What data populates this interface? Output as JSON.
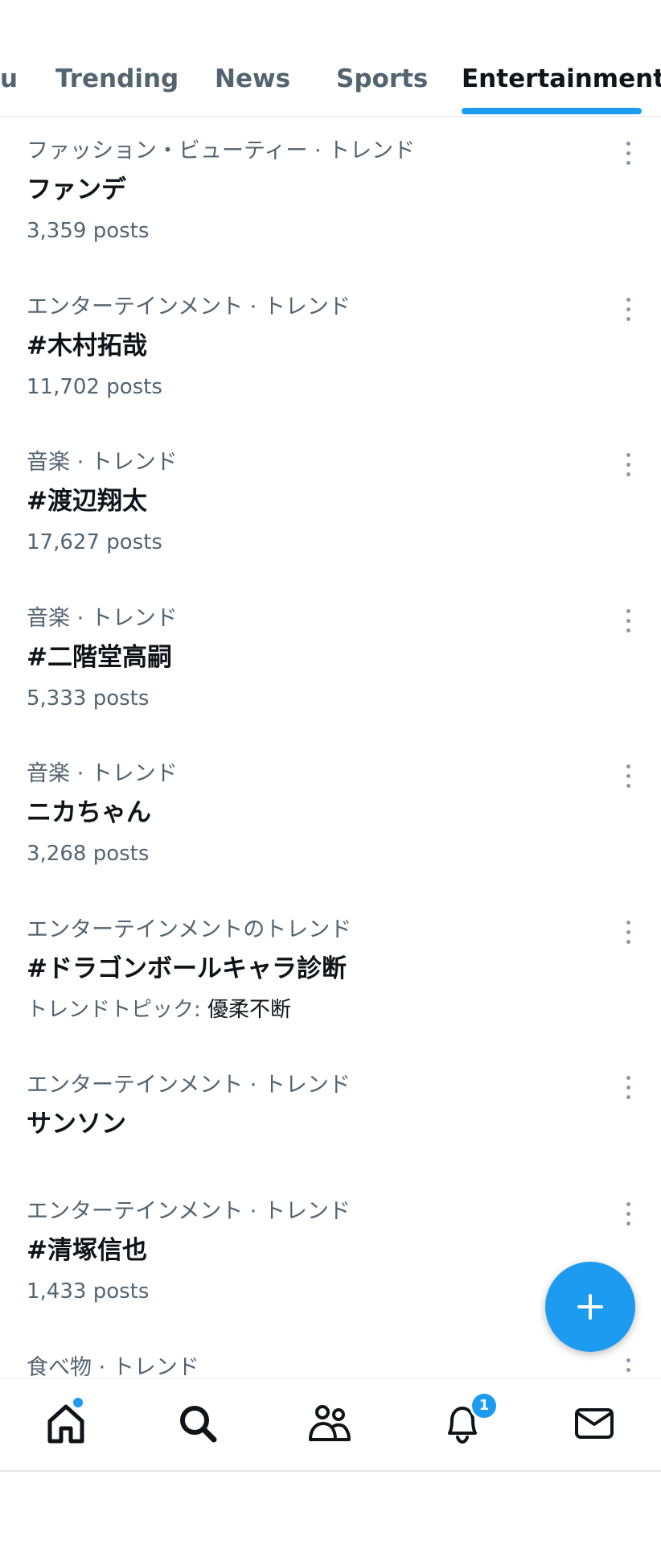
{
  "tabs": [
    {
      "label": "u",
      "active": false
    },
    {
      "label": "Trending",
      "active": false
    },
    {
      "label": "News",
      "active": false
    },
    {
      "label": "Sports",
      "active": false
    },
    {
      "label": "Entertainment",
      "active": true
    }
  ],
  "trends": [
    {
      "category": "ファッション・ビューティー · トレンド",
      "name": "ファンデ",
      "posts": "3,359 posts"
    },
    {
      "category": "エンターテインメント · トレンド",
      "name": "#木村拓哉",
      "posts": "11,702 posts"
    },
    {
      "category": "音楽 · トレンド",
      "name": "#渡辺翔太",
      "posts": "17,627 posts"
    },
    {
      "category": "音楽 · トレンド",
      "name": "#二階堂高嗣",
      "posts": "5,333 posts"
    },
    {
      "category": "音楽 · トレンド",
      "name": "ニカちゃん",
      "posts": "3,268 posts"
    },
    {
      "category": "エンターテインメントのトレンド",
      "name": "#ドラゴンボールキャラ診断",
      "topic_label": "トレンドトピック:",
      "topic_value": "優柔不断"
    },
    {
      "category": "エンターテインメント · トレンド",
      "name": "サンソン"
    },
    {
      "category": "エンターテインメント · トレンド",
      "name": "#清塚信也",
      "posts": "1,433 posts"
    },
    {
      "category": "食べ物 · トレンド"
    }
  ],
  "fab": {
    "icon": "plus-icon",
    "color": "#1d9bf0"
  },
  "bottom_nav": {
    "items": [
      {
        "icon": "home-icon",
        "has_dot": true
      },
      {
        "icon": "search-icon"
      },
      {
        "icon": "communities-icon"
      },
      {
        "icon": "notifications-icon",
        "badge": "1"
      },
      {
        "icon": "messages-icon"
      }
    ]
  },
  "colors": {
    "accent": "#1d9bf0",
    "secondary_text": "#536471",
    "primary_text": "#0f1419"
  }
}
